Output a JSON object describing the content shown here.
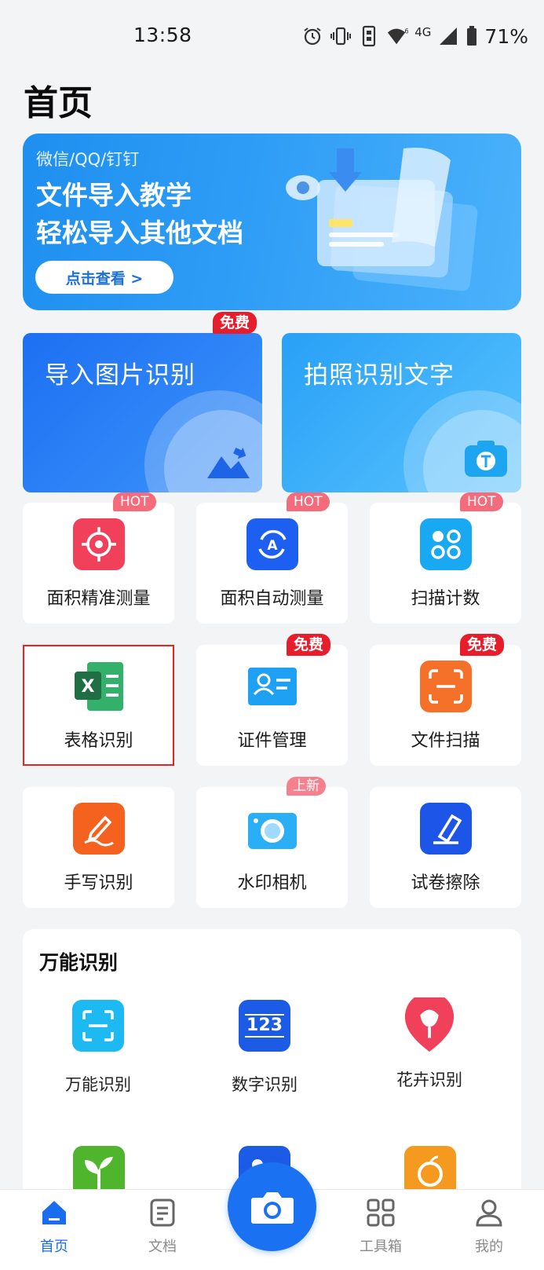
{
  "status_bar": {
    "time": "13:58",
    "network": "4G",
    "battery": "71%"
  },
  "page": {
    "title": "首页"
  },
  "banner": {
    "subtitle": "微信/QQ/钉钉",
    "line1": "文件导入教学",
    "line2": "轻松导入其他文档",
    "button": "点击查看 >"
  },
  "big_cards": [
    {
      "label": "导入图片识别",
      "badge": "免费"
    },
    {
      "label": "拍照识别文字"
    }
  ],
  "tools": [
    {
      "label": "面积精准测量",
      "badge": "HOT",
      "icon": "target-icon",
      "color": "#f0405a"
    },
    {
      "label": "面积自动测量",
      "badge": "HOT",
      "icon": "auto-measure-icon",
      "color": "#1d5ff0"
    },
    {
      "label": "扫描计数",
      "badge": "HOT",
      "icon": "count-icon",
      "color": "#19a8f2"
    },
    {
      "label": "表格识别",
      "icon": "excel-icon",
      "color": "#21a366"
    },
    {
      "label": "证件管理",
      "badge": "免费",
      "icon": "id-card-icon",
      "color": "#1ea0f5"
    },
    {
      "label": "文件扫描",
      "badge": "免费",
      "icon": "file-scan-icon",
      "color": "#f5712a"
    },
    {
      "label": "手写识别",
      "icon": "handwriting-icon",
      "color": "#f5621f"
    },
    {
      "label": "水印相机",
      "badge": "上新",
      "icon": "watermark-camera-icon",
      "color": "#2aaef5"
    },
    {
      "label": "试卷擦除",
      "icon": "eraser-icon",
      "color": "#1d55e8"
    }
  ],
  "section": {
    "title": "万能识别",
    "items": [
      {
        "label": "万能识别",
        "icon": "scan-frame-icon"
      },
      {
        "label": "数字识别",
        "icon": "number-icon",
        "text": "123"
      },
      {
        "label": "花卉识别",
        "icon": "flower-icon"
      }
    ]
  },
  "nav": [
    {
      "label": "首页",
      "icon": "home-icon",
      "active": true
    },
    {
      "label": "文档",
      "icon": "document-icon"
    },
    {
      "label": "工具箱",
      "icon": "toolbox-icon"
    },
    {
      "label": "我的",
      "icon": "profile-icon"
    }
  ],
  "colors": {
    "brand": "#1a72f2",
    "free_badge": "#e81d2b",
    "hot_badge": "#f46b7c"
  }
}
